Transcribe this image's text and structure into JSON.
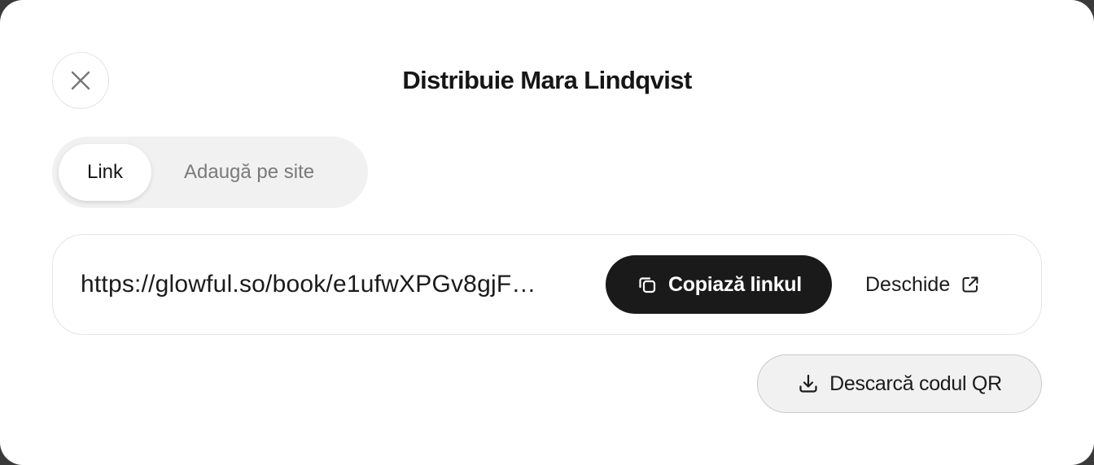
{
  "modal": {
    "title": "Distribuie Mara Lindqvist"
  },
  "tabs": [
    {
      "label": "Link",
      "active": true
    },
    {
      "label": "Adaugă pe site",
      "active": false
    }
  ],
  "share_link": {
    "url": "https://glowful.so/book/e1ufwXPGv8gjF…",
    "copy_label": "Copiază linkul",
    "open_label": "Deschide"
  },
  "qr": {
    "download_label": "Descarcă codul QR"
  },
  "icons": {
    "close": "close-icon",
    "copy": "copy-icon",
    "external": "external-link-icon",
    "download": "download-icon"
  },
  "colors": {
    "primary_button": "#1a1a1a",
    "tab_track": "#f1f1f1",
    "border": "#e4e4e4"
  }
}
